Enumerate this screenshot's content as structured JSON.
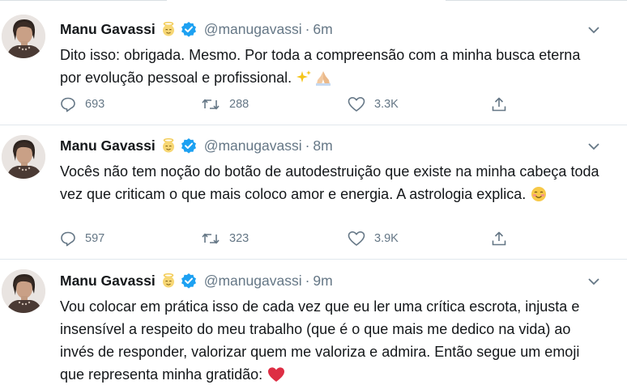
{
  "tweets": [
    {
      "name": "Manu Gavassi",
      "handle": "@manugavassi",
      "separator": "·",
      "time": "6m",
      "text": "Dito isso: obrigada. Mesmo. Por toda a compreensão com a minha busca eterna por evolução pessoal e profissional.",
      "emojis": [
        "sparkles-icon",
        "folded-hands-icon"
      ],
      "replies": "693",
      "retweets": "288",
      "likes": "3.3K"
    },
    {
      "name": "Manu Gavassi",
      "handle": "@manugavassi",
      "separator": "·",
      "time": "8m",
      "text": "Vocês não tem noção do botão de autodestruição que existe na minha cabeça toda vez que criticam o que mais coloco amor e energia. A astrologia explica.",
      "emojis": [
        "smiling-blush-face-icon"
      ],
      "replies": "597",
      "retweets": "323",
      "likes": "3.9K"
    },
    {
      "name": "Manu Gavassi",
      "handle": "@manugavassi",
      "separator": "·",
      "time": "9m",
      "text": "Vou colocar em prática isso de cada vez que eu ler uma crítica escrota, injusta e insensível a respeito do meu trabalho (que é o que mais me dedico na vida) ao invés de responder, valorizar quem me valoriza e admira. Então segue um emoji que representa minha gratidão:",
      "emojis": [
        "red-heart-icon"
      ]
    }
  ],
  "colors": {
    "text": "#14171a",
    "secondary": "#657786",
    "verified": "#1da1f2",
    "divider": "#e1e8ed",
    "heart": "#e0245e"
  }
}
